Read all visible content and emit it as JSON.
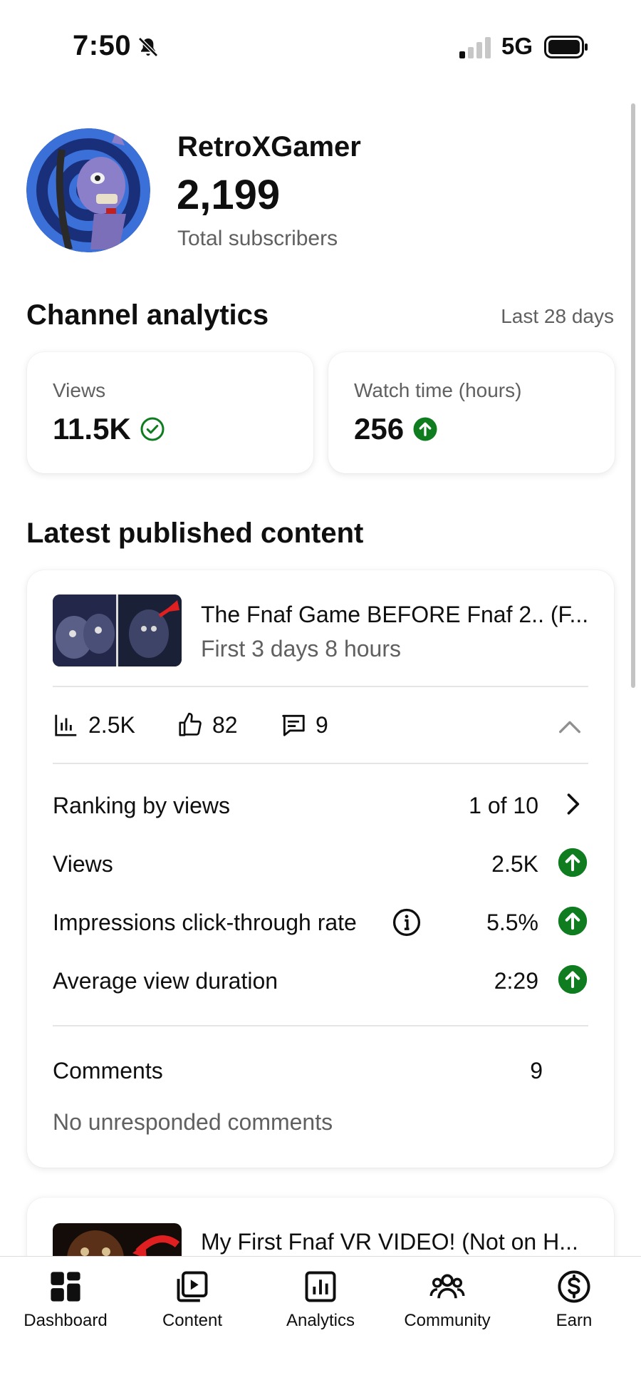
{
  "status_bar": {
    "time": "7:50",
    "network": "5G",
    "icons": [
      "bell-slash-icon",
      "signal-icon",
      "battery-icon"
    ]
  },
  "channel": {
    "name": "RetroXGamer",
    "subscribers": "2,199",
    "subscribers_label": "Total subscribers"
  },
  "analytics": {
    "title": "Channel analytics",
    "range": "Last 28 days",
    "views": {
      "label": "Views",
      "value": "11.5K",
      "icon": "check-circle-icon"
    },
    "watch_time": {
      "label": "Watch time (hours)",
      "value": "256",
      "icon": "arrow-up-circle-icon"
    }
  },
  "latest": {
    "title": "Latest published content",
    "video": {
      "title": "The Fnaf Game BEFORE Fnaf 2.. (F...",
      "subtitle": "First 3 days 8 hours",
      "stats": {
        "views": "2.5K",
        "likes": "82",
        "comments": "9"
      },
      "rows": [
        {
          "label": "Ranking by views",
          "value": "1 of 10",
          "trail": "chevron-right-icon"
        },
        {
          "label": "Views",
          "value": "2.5K",
          "trail": "arrow-up-circle-icon"
        },
        {
          "label": "Impressions click-through rate",
          "value": "5.5%",
          "trail": "arrow-up-circle-icon"
        },
        {
          "label": "Average view duration",
          "value": "2:29",
          "trail": "arrow-up-circle-icon"
        }
      ],
      "comments_label": "Comments",
      "comments_value": "9",
      "no_unresponded": "No unresponded comments"
    },
    "next_video_title": "My First Fnaf VR VIDEO! (Not on H..."
  },
  "nav": [
    {
      "label": "Dashboard",
      "icon": "dashboard-icon"
    },
    {
      "label": "Content",
      "icon": "content-icon"
    },
    {
      "label": "Analytics",
      "icon": "analytics-icon"
    },
    {
      "label": "Community",
      "icon": "community-icon"
    },
    {
      "label": "Earn",
      "icon": "earn-icon"
    }
  ],
  "colors": {
    "accent_green": "#0e7c1f",
    "text_primary": "#0f0f0f",
    "text_secondary": "#606060"
  }
}
